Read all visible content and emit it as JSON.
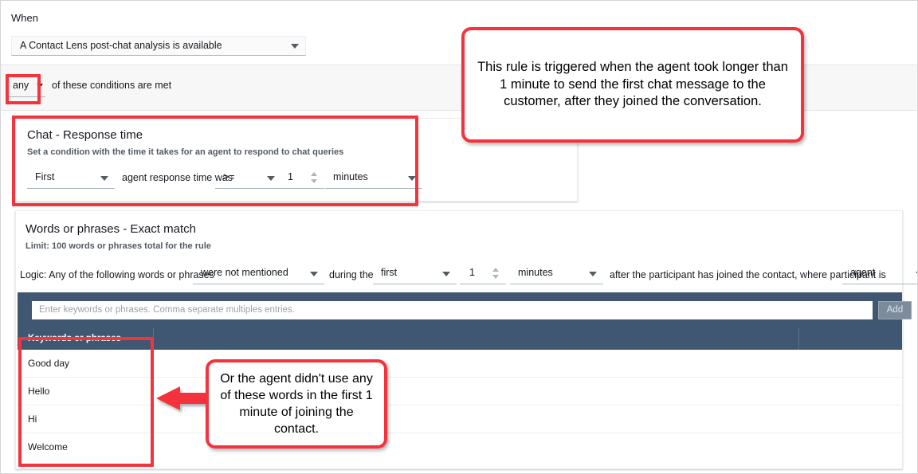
{
  "when": {
    "label": "When",
    "trigger_value": "A Contact Lens post-chat analysis is available"
  },
  "conditions_bar": {
    "match_value": "any",
    "text": "of these conditions are met"
  },
  "chat_response_time": {
    "title": "Chat - Response time",
    "subtitle": "Set a condition with the time it takes for an agent to respond to chat queries",
    "occurrence_value": "First",
    "middle_text": "agent response time was",
    "operator_value": ">=",
    "amount_value": "1",
    "unit_value": "minutes"
  },
  "words_phrases": {
    "title": "Words or phrases - Exact match",
    "subtitle": "Limit: 100 words or phrases total for the rule",
    "logic_prefix": "Logic: Any of the following words or phrases",
    "mentioned_value": "were not mentioned",
    "during_text": "during the",
    "ordinal_value": "first",
    "amount_value": "1",
    "unit_value": "minutes",
    "after_text": "after the participant has joined the contact, where participant is",
    "participant_value": "agent",
    "input_placeholder": "Enter keywords or phrases. Comma separate multiples entries.",
    "add_label": "Add",
    "table": {
      "columns": [
        "Keywords or phrases",
        "",
        ""
      ],
      "rows": [
        "Good day",
        "Hello",
        "Hi",
        "Welcome"
      ]
    }
  },
  "annotations": {
    "callout_1": "This rule is triggered when the agent took longer than 1 minute to send the first chat message to the customer, after they joined the conversation.",
    "callout_2": "Or the agent didn't use any of these words in the first 1 minute of joining the contact."
  },
  "colors": {
    "annotation_red": "#f4333d",
    "table_header_blue": "#3f5771",
    "text_dark": "#16191f"
  }
}
